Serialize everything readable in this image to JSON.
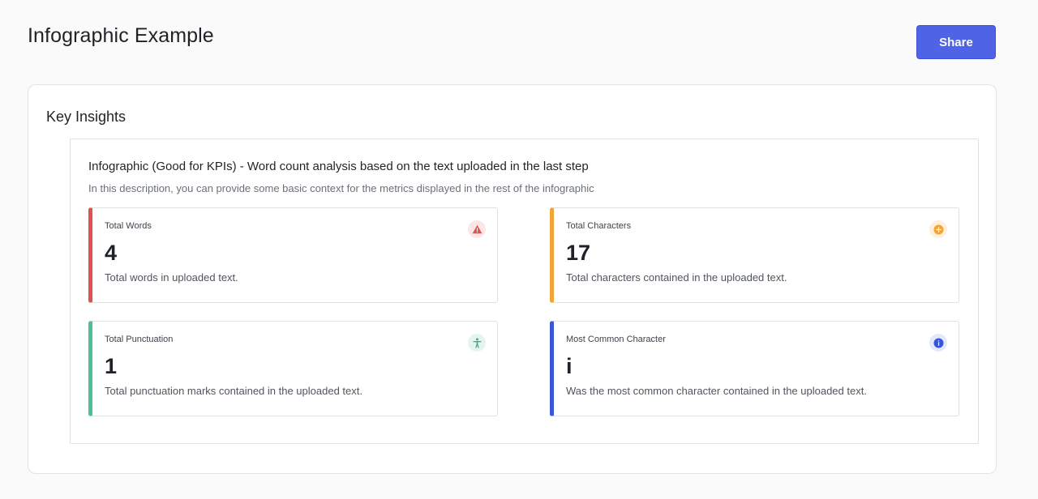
{
  "header": {
    "title": "Infographic Example",
    "share_label": "Share"
  },
  "insights": {
    "title": "Key Insights",
    "infographic": {
      "title": "Infographic (Good for KPIs) - Word count analysis based on the text uploaded in the last step",
      "description": "In this description, you can provide some basic context for the metrics displayed in the rest of the infographic",
      "metrics": [
        {
          "label": "Total Words",
          "value": "4",
          "description": "Total words in uploaded text.",
          "icon": "warning-icon",
          "color": "#e0514f"
        },
        {
          "label": "Total Characters",
          "value": "17",
          "description": "Total characters contained in the uploaded text.",
          "icon": "plus-circle-icon",
          "color": "#f0a43a"
        },
        {
          "label": "Total Punctuation",
          "value": "1",
          "description": "Total punctuation marks contained in the uploaded text.",
          "icon": "accessibility-icon",
          "color": "#4cbf93"
        },
        {
          "label": "Most Common Character",
          "value": "i",
          "description": "Was the most common character contained in the uploaded text.",
          "icon": "info-icon",
          "color": "#3a55d8"
        }
      ]
    }
  }
}
